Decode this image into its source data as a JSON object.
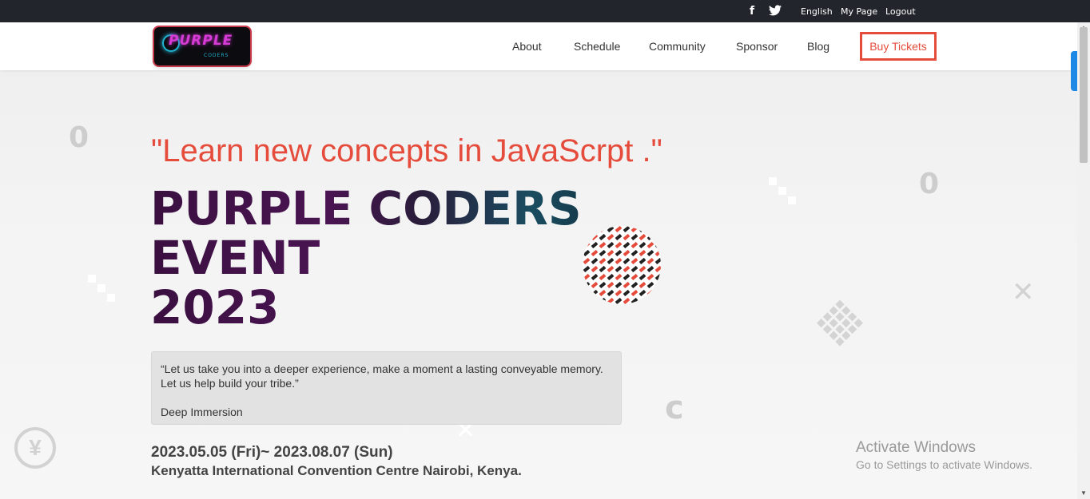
{
  "topbar": {
    "social_icons": [
      "facebook-icon",
      "twitter-icon"
    ],
    "facebook_glyph": "f",
    "twitter_glyph": "🐦",
    "links": [
      "English",
      "My Page",
      "Logout"
    ]
  },
  "nav": {
    "logo_text": "PURPLE",
    "logo_sub": "CODERS",
    "items": [
      "About",
      "Schedule",
      "Community",
      "Sponsor",
      "Blog"
    ],
    "cta": "Buy Tickets"
  },
  "hero": {
    "tagline": "\"Learn new concepts in JavaScrpt .\"",
    "title_lines": [
      "PURPLE CODERS",
      "EVENT",
      "2023"
    ],
    "quote": "“Let us take you into a deeper experience, make a moment a lasting conveyable memory. Let us help build your tribe.”",
    "quote_author": "Deep Immersion",
    "dates": "2023.05.05 (Fri)~ 2023.08.07 (Sun)",
    "venue": "Kenyatta International Convention Centre Nairobi, Kenya."
  },
  "watermark": {
    "line1": "Activate Windows",
    "line2": "Go to Settings to activate Windows."
  },
  "colors": {
    "accent": "#e54c3c",
    "topbar_bg": "#22252c",
    "title_purple": "#3a1040",
    "title_teal": "#1a4c60",
    "scroll_tab": "#1e88e5"
  }
}
